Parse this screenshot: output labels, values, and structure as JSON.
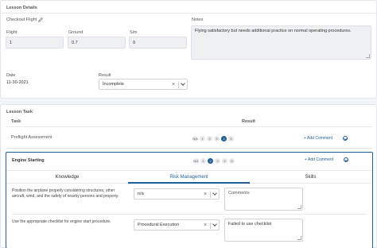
{
  "lesson_details": {
    "title": "Lesson Details",
    "checkout_label": "Checkout Flight",
    "flight": {
      "label": "Flight",
      "value": "1"
    },
    "ground": {
      "label": "Ground",
      "value": "0.7"
    },
    "sim": {
      "label": "Sim",
      "value": "0"
    },
    "notes": {
      "label": "Notes",
      "value": "Flying satisfactory but needs additional practice on normal operating procedures."
    },
    "date": {
      "label": "Date",
      "value": "11-30-2021"
    },
    "result": {
      "label": "Result",
      "value": "Incomplete"
    }
  },
  "lesson_task": {
    "title": "Lesson Task",
    "col_task": "Task",
    "col_result": "Result",
    "tasks": [
      {
        "name": "Preflight Assessment",
        "scores": [
          "N/A",
          "1",
          "2",
          "3",
          "4",
          "5"
        ],
        "selected": "4",
        "add_comment": "+ Add Comment"
      },
      {
        "name": "Engine Starting",
        "scores": [
          "N/A",
          "1",
          "2",
          "3",
          "4",
          "5"
        ],
        "selected": "2",
        "add_comment": "+ Add Comment"
      }
    ],
    "tabs": [
      "Knowledge",
      "Risk Management",
      "Skills"
    ],
    "active_tab": "Risk Management",
    "items": [
      {
        "text": "Position the airplane properly considering structures, other aircraft, wind, and the safety of nearby persons and property.",
        "select": "n/a",
        "comment": "Comments"
      },
      {
        "text": "Use the appropriate checklist for engine start procedure.",
        "select": "Procedural Execution",
        "comment": "Failed to use checklist"
      }
    ]
  },
  "colors": {
    "accent": "#1f5f97",
    "page_bg": "#f1f4f8"
  }
}
